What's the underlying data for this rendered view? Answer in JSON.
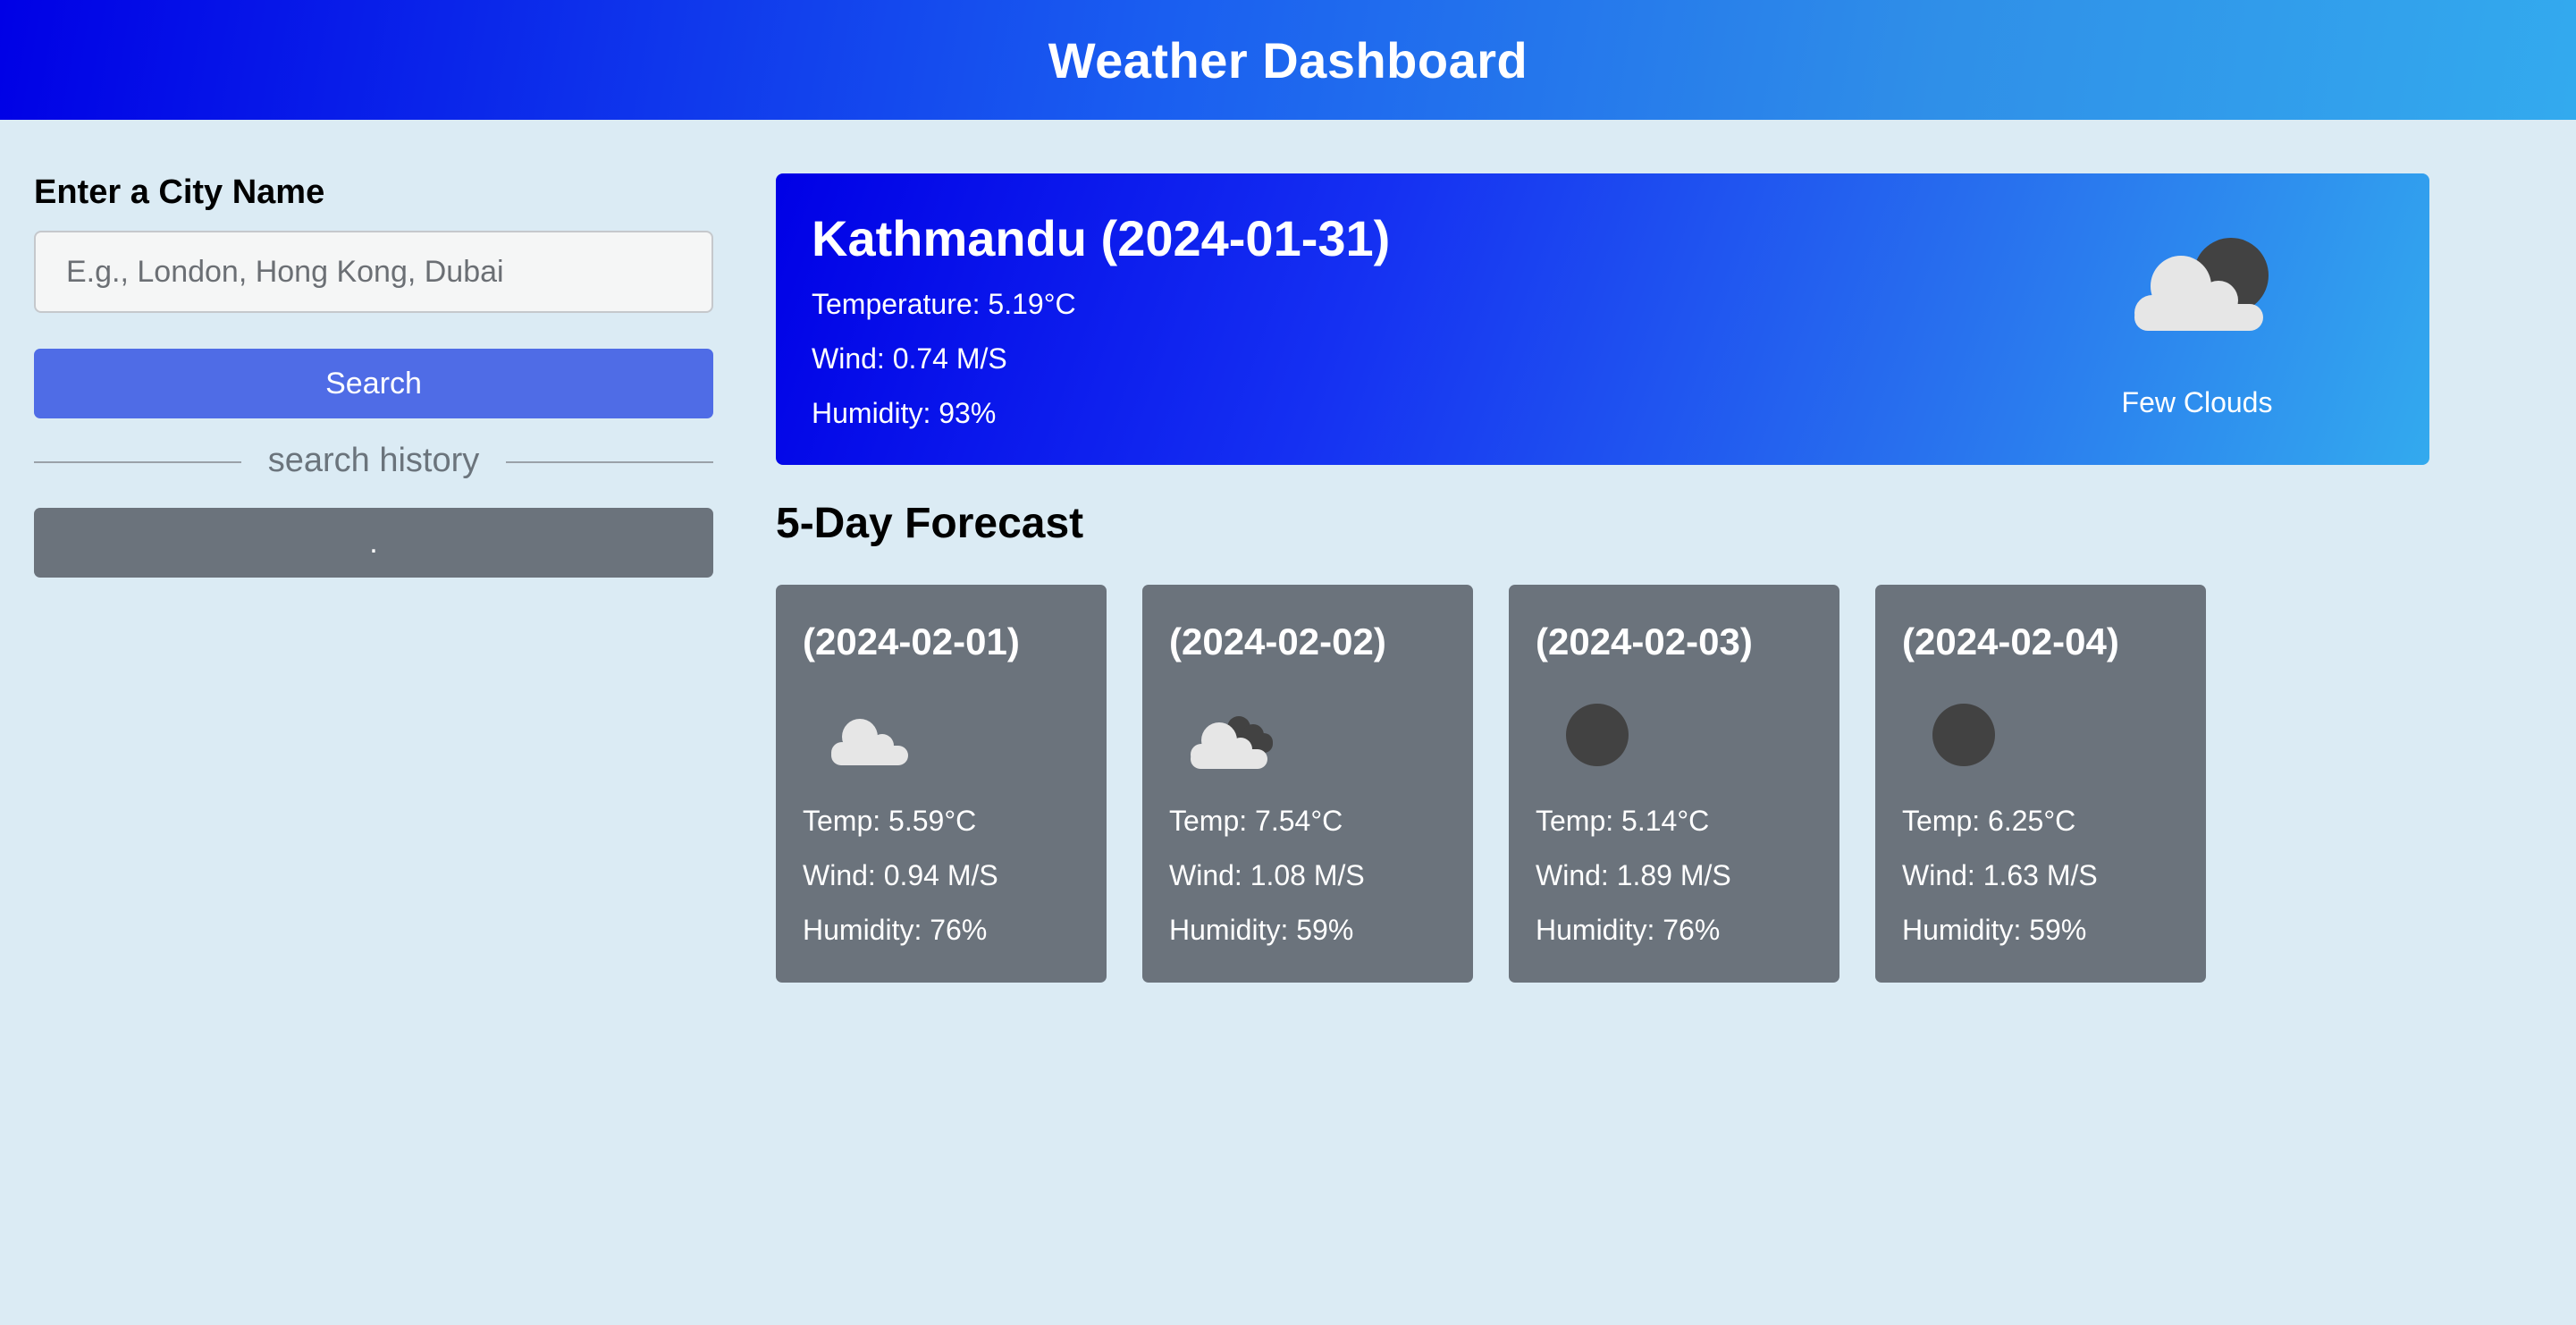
{
  "header": {
    "title": "Weather Dashboard"
  },
  "sidebar": {
    "city_label": "Enter a City Name",
    "input_placeholder": "E.g., London, Hong Kong, Dubai",
    "input_value": "",
    "search_label": "Search",
    "history_label": "search history",
    "history_items": [
      "."
    ]
  },
  "current": {
    "title": "Kathmandu (2024-01-31)",
    "temperature": "Temperature: 5.19°C",
    "wind": "Wind: 0.74 M/S",
    "humidity": "Humidity: 93%",
    "description": "Few Clouds",
    "icon": "cloud-moon-icon"
  },
  "forecast": {
    "heading": "5-Day Forecast",
    "days": [
      {
        "date": "(2024-02-01)",
        "icon": "cloud-icon",
        "temp": "Temp: 5.59°C",
        "wind": "Wind: 0.94 M/S",
        "humidity": "Humidity: 76%"
      },
      {
        "date": "(2024-02-02)",
        "icon": "broken-clouds-icon",
        "temp": "Temp: 7.54°C",
        "wind": "Wind: 1.08 M/S",
        "humidity": "Humidity: 59%"
      },
      {
        "date": "(2024-02-03)",
        "icon": "moon-icon",
        "temp": "Temp: 5.14°C",
        "wind": "Wind: 1.89 M/S",
        "humidity": "Humidity: 76%"
      },
      {
        "date": "(2024-02-04)",
        "icon": "moon-icon",
        "temp": "Temp: 6.25°C",
        "wind": "Wind: 1.63 M/S",
        "humidity": "Humidity: 59%"
      }
    ]
  },
  "colors": {
    "background": "#dbebf4",
    "header_start": "#0000e6",
    "header_end": "#33aaee",
    "search_button": "#4f6ce6",
    "card_gray": "#6b737c",
    "icon_dark": "#424242",
    "icon_cloud": "#e6e6e6"
  }
}
